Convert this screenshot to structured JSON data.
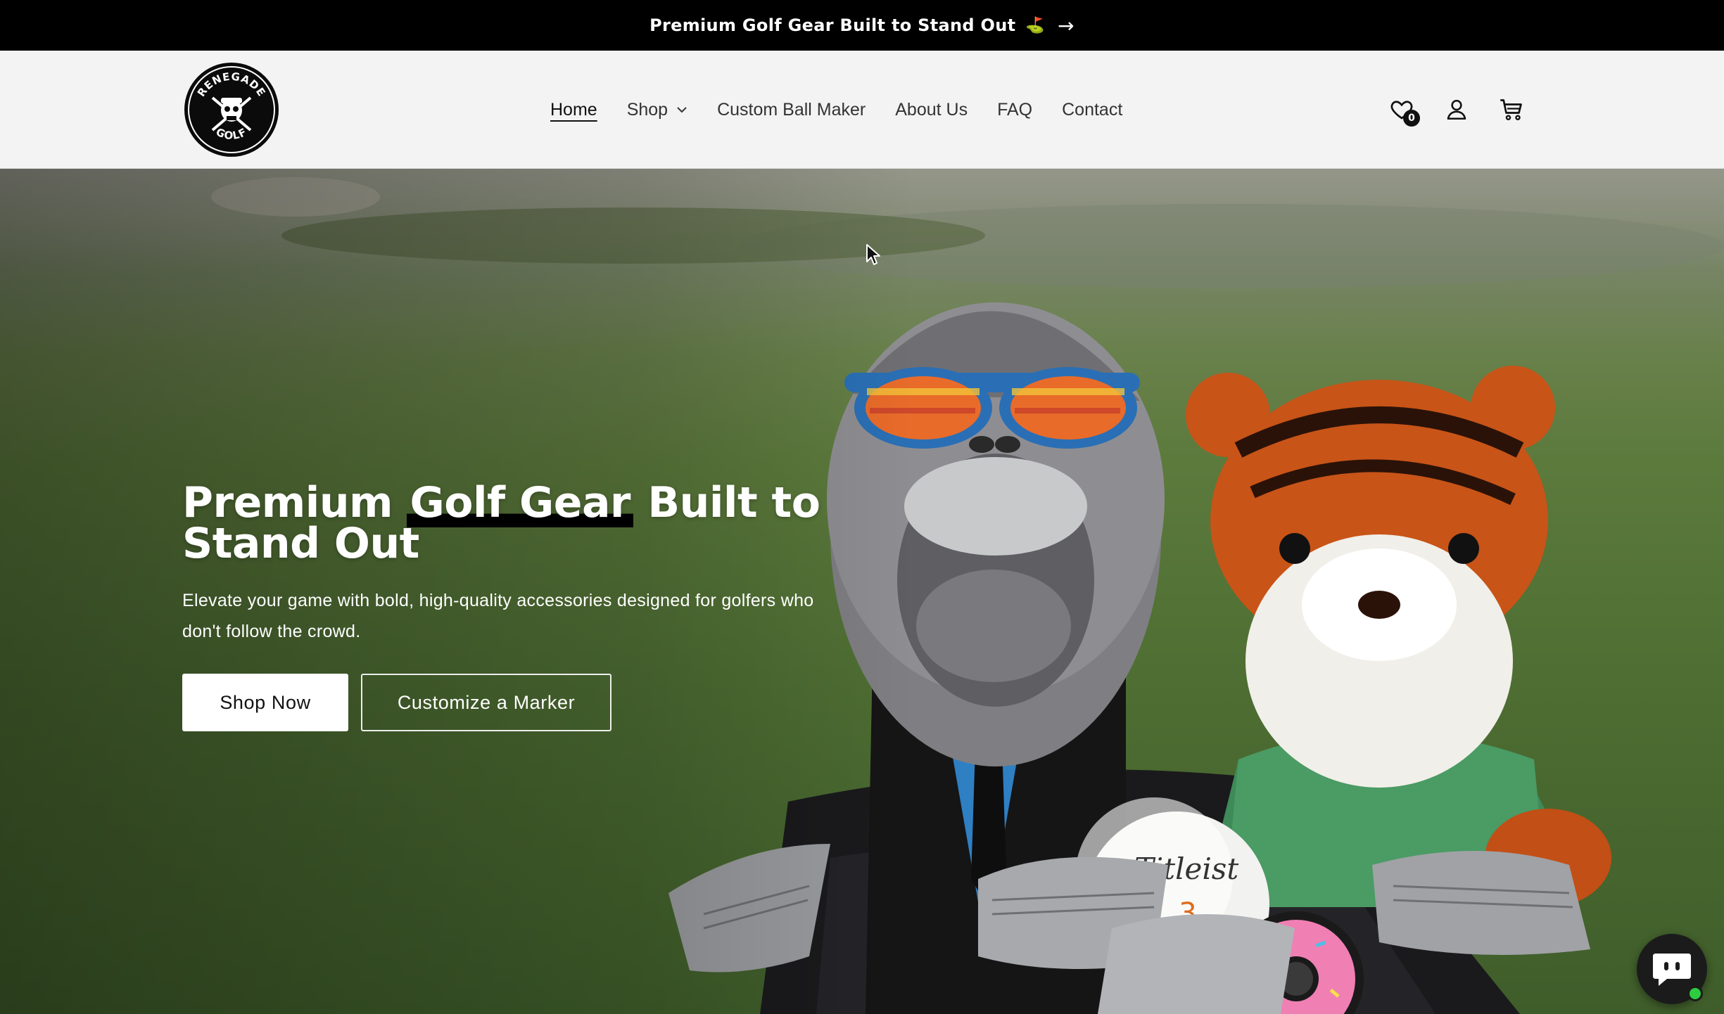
{
  "announcement": {
    "text": "Premium Golf Gear Built to Stand Out",
    "emoji": "⛳",
    "arrow": "→"
  },
  "logo": {
    "top_text": "RENEGADE",
    "bottom_text": "GOLF"
  },
  "nav": {
    "items": [
      {
        "label": "Home",
        "active": true
      },
      {
        "label": "Shop",
        "has_dropdown": true
      },
      {
        "label": "Custom Ball Maker"
      },
      {
        "label": "About Us"
      },
      {
        "label": "FAQ"
      },
      {
        "label": "Contact"
      }
    ]
  },
  "header_icons": {
    "wishlist_count": "0",
    "icons": [
      "heart-icon",
      "account-icon",
      "cart-icon"
    ]
  },
  "hero": {
    "title_part1": "Premium ",
    "title_highlight": "Golf Gear",
    "title_part2": " Built to Stand Out",
    "subtitle": "Elevate your game with bold, high-quality accessories designed for golfers who don't follow the crowd.",
    "primary_button": "Shop Now",
    "secondary_button": "Customize a Marker",
    "ball_brand": "Titleist",
    "ball_number": "3"
  },
  "colors": {
    "announcement_bg": "#000000",
    "header_bg": "#f3f3f3",
    "chat_online": "#2ecc40"
  }
}
